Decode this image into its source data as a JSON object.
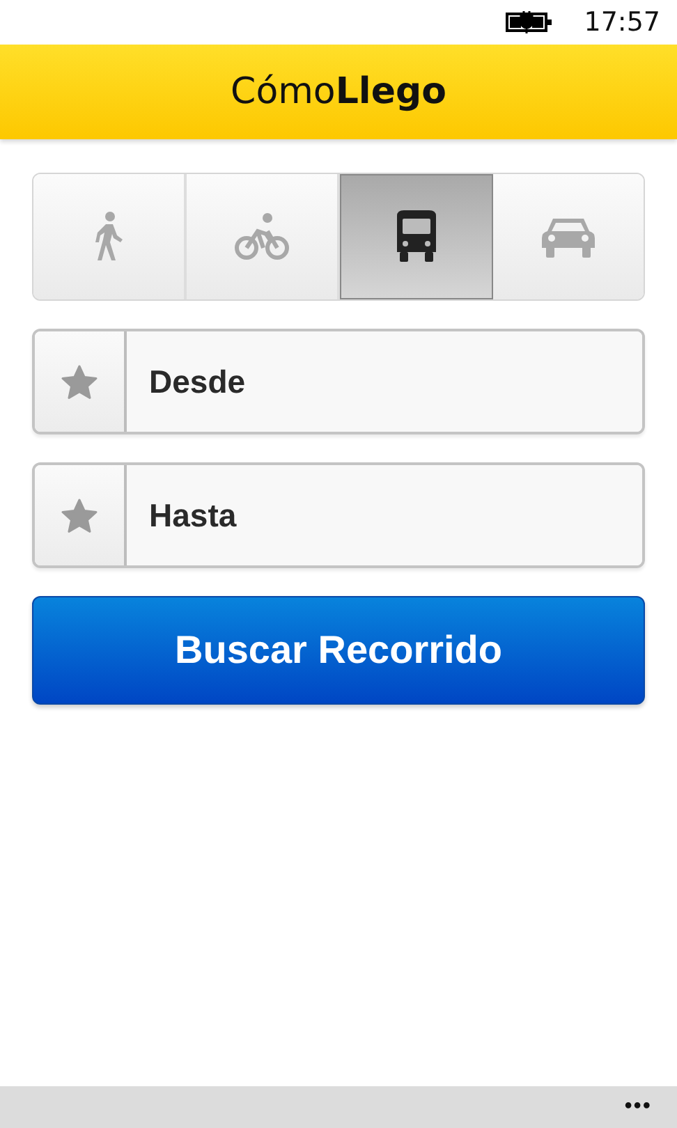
{
  "status_bar": {
    "time": "17:57"
  },
  "header": {
    "logo": "Cómo**Llego**"
  },
  "modes": [
    {
      "kind": "walk",
      "selected": false
    },
    {
      "kind": "bike",
      "selected": false
    },
    {
      "kind": "bus",
      "selected": true
    },
    {
      "kind": "car",
      "selected": false
    }
  ],
  "fields": [
    {
      "placeholder": "Desde"
    },
    {
      "placeholder": "Hasta"
    }
  ],
  "search_button": "Buscar Recorrido",
  "app_bar": {
    "more": "•••"
  }
}
